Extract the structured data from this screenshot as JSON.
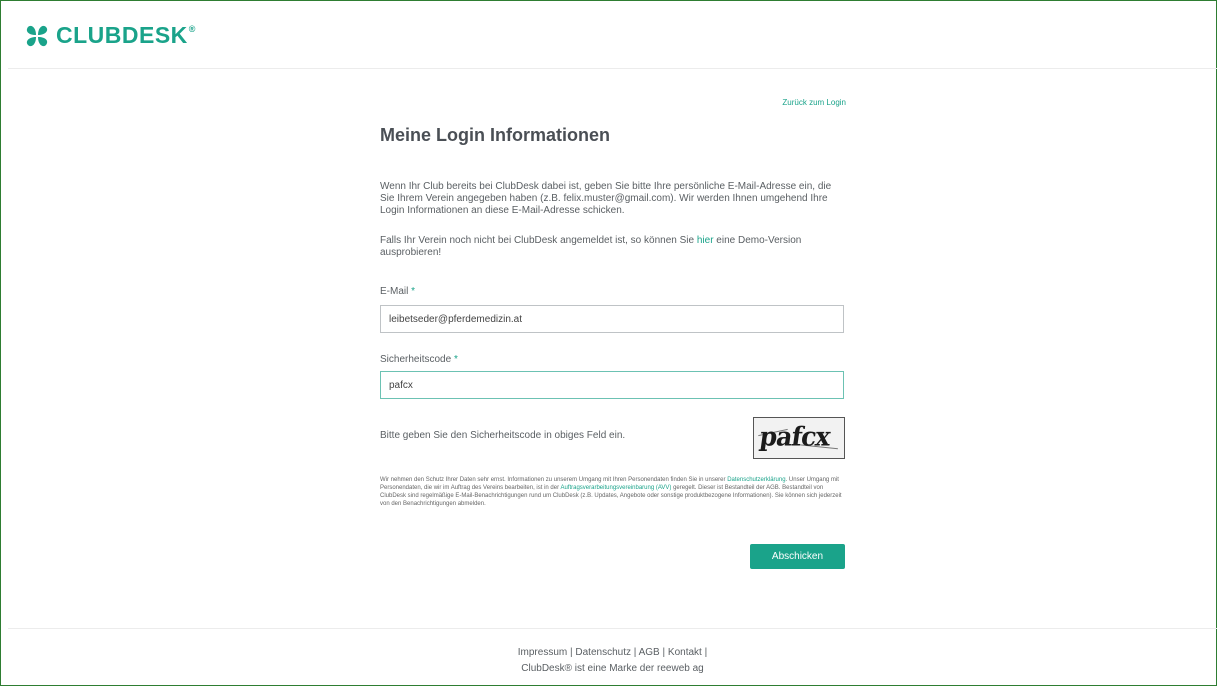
{
  "brand": {
    "name": "CLUBDESK",
    "registered": "®",
    "accent": "#1aa38a"
  },
  "nav": {
    "back_to_login": "Zurück zum Login"
  },
  "page": {
    "title": "Meine Login Informationen",
    "intro": "Wenn Ihr Club bereits bei ClubDesk dabei ist, geben Sie bitte Ihre persönliche E-Mail-Adresse ein, die Sie Ihrem Verein angegeben haben (z.B. felix.muster@gmail.com). Wir werden Ihnen umgehend Ihre Login Informationen an diese E-Mail-Adresse schicken.",
    "demo_before": "Falls Ihr Verein noch nicht bei ClubDesk angemeldet ist, so können Sie ",
    "demo_link": "hier",
    "demo_after": " eine Demo-Version ausprobieren!"
  },
  "form": {
    "email_label": "E-Mail",
    "email_value": "leibetseder@pferdemedizin.at",
    "code_label": "Sicherheitscode",
    "code_value": "pafcx",
    "required_mark": "*",
    "captcha_hint": "Bitte geben Sie den Sicherheitscode in obiges Feld ein.",
    "captcha_text": "pafcx",
    "submit_label": "Abschicken"
  },
  "privacy": {
    "part1": "Wir nehmen den Schutz Ihrer Daten sehr ernst. Informationen zu unserem Umgang mit Ihren Personendaten finden Sie in unserer ",
    "link1": "Datenschutzerklärung",
    "part2": ". Unser Umgang mit Personendaten, die wir im Auftrag des Vereins bearbeiten, ist in der ",
    "link2": "Auftragsverarbeitungsvereinbarung (AVV)",
    "part3": " geregelt. Dieser ist Bestandteil der AGB. Bestandteil von ClubDesk sind regelmäßige E-Mail-Benachrichtigungen rund um ClubDesk (z.B. Updates, Angebote oder sonstige produktbezogene Informationen). Sie können sich jederzeit von den Benachrichtigungen abmelden."
  },
  "footer": {
    "impressum": "Impressum",
    "datenschutz": "Datenschutz",
    "agb": "AGB",
    "kontakt": "Kontakt",
    "separator": "|",
    "brand_line": "ClubDesk® ist eine Marke der reeweb ag"
  }
}
